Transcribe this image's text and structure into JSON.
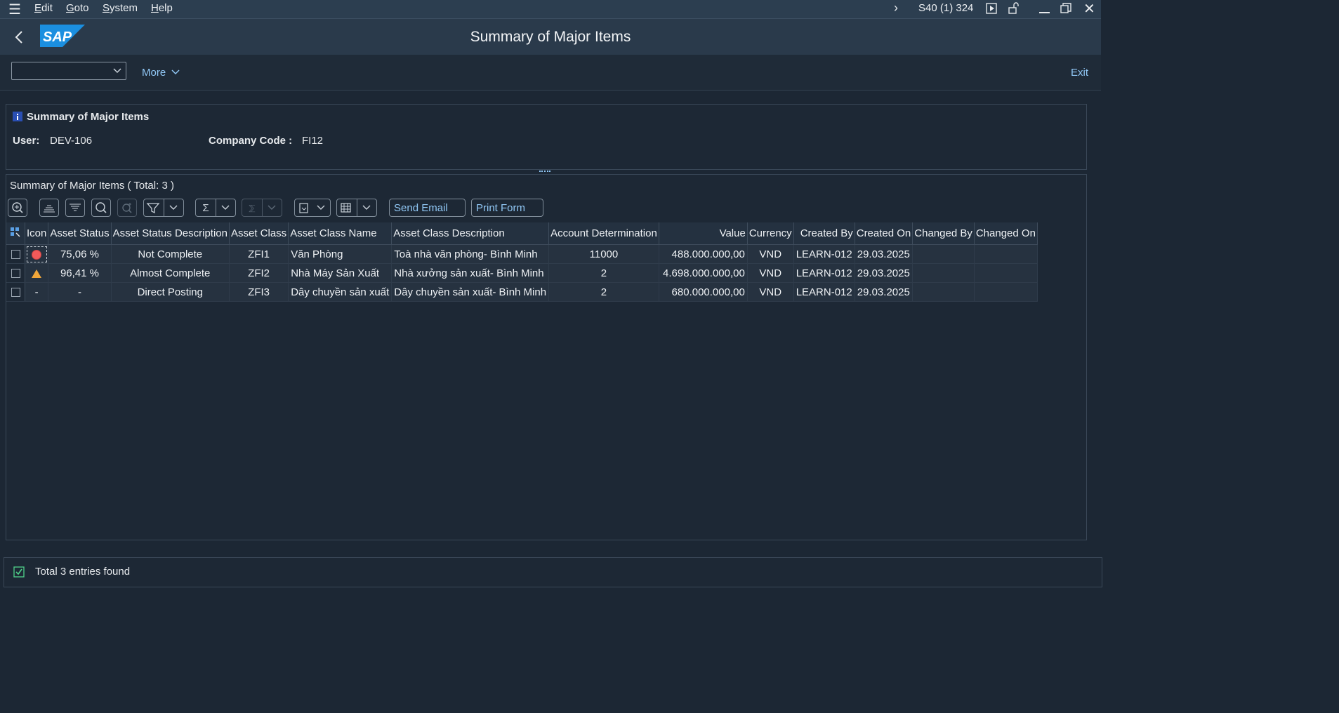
{
  "menubar": {
    "items": [
      {
        "label": "Edit",
        "u": "E",
        "rest": "dit"
      },
      {
        "label": "Goto",
        "u": "G",
        "rest": "oto"
      },
      {
        "label": "System",
        "u": "S",
        "rest": "ystem"
      },
      {
        "label": "Help",
        "u": "H",
        "rest": "elp"
      }
    ],
    "session": "S40 (1) 324"
  },
  "titlebar": {
    "title": "Summary of Major Items",
    "logo": "SAP"
  },
  "toolbar": {
    "more_label": "More",
    "exit_label": "Exit",
    "dropdown_value": ""
  },
  "header": {
    "title": "Summary of Major Items",
    "user_label": "User:",
    "user_value": "DEV-106",
    "company_label": "Company Code :",
    "company_value": "FI12"
  },
  "alv": {
    "title": "Summary of Major Items ( Total:  3 )",
    "send_email": "Send Email",
    "print_form": "Print Form",
    "columns": [
      "Icon",
      "Asset Status",
      "Asset Status Description",
      "Asset Class",
      "Asset Class Name",
      "Asset Class Description",
      "Account Determination",
      "Value",
      "Currency",
      "Created By",
      "Created On",
      "Changed By",
      "Changed On"
    ],
    "rows": [
      {
        "icon": "red-circle-icon",
        "status": "75,06 %",
        "status_desc": "Not Complete",
        "class": "ZFI1",
        "class_name": "Văn Phòng",
        "class_desc": "Toà nhà văn phòng- Bình Minh",
        "acct": "11000",
        "value": "488.000.000,00",
        "currency": "VND",
        "created_by": "LEARN-012",
        "created_on": "29.03.2025",
        "changed_by": "",
        "changed_on": ""
      },
      {
        "icon": "warning-triangle-icon",
        "status": "96,41 %",
        "status_desc": "Almost Complete",
        "class": "ZFI2",
        "class_name": "Nhà Máy Sản Xuất",
        "class_desc": "Nhà xưởng sản xuất- Bình Minh",
        "acct": "2",
        "value": "4.698.000.000,00",
        "currency": "VND",
        "created_by": "LEARN-012",
        "created_on": "29.03.2025",
        "changed_by": "",
        "changed_on": ""
      },
      {
        "icon": "-",
        "status": "-",
        "status_desc": "Direct Posting",
        "class": "ZFI3",
        "class_name": "Dây chuyền sản xuất",
        "class_desc": "Dây chuyền sản xuất- Bình Minh",
        "acct": "2",
        "value": "680.000.000,00",
        "currency": "VND",
        "created_by": "LEARN-012",
        "created_on": "29.03.2025",
        "changed_by": "",
        "changed_on": ""
      }
    ]
  },
  "statusbar": {
    "message": "Total 3 entries found"
  },
  "colors": {
    "background": "#1c2734",
    "link": "#91c8f6",
    "status_error": "#f05a5a",
    "status_warning": "#f0a63a"
  }
}
